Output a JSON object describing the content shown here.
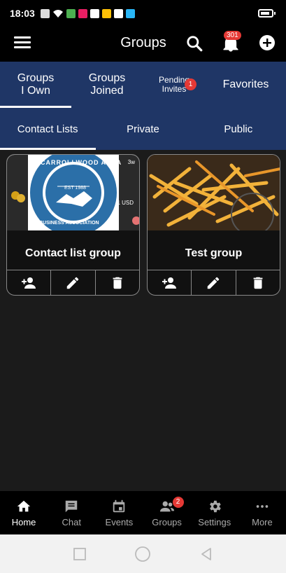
{
  "status_bar": {
    "time": "18:03"
  },
  "app_bar": {
    "title": "Groups",
    "notification_count": "301"
  },
  "main_tabs": [
    {
      "label": "Groups I Own",
      "active": true
    },
    {
      "label": "Groups Joined",
      "active": false
    },
    {
      "label": "Pending Invites",
      "badge": "1",
      "active": false
    },
    {
      "label": "Favorites",
      "active": false
    }
  ],
  "sub_tabs": [
    {
      "label": "Contact Lists",
      "active": true
    },
    {
      "label": "Private",
      "active": false
    },
    {
      "label": "Public",
      "active": false
    }
  ],
  "cards": [
    {
      "name": "Contact list group",
      "image_logo_top": "CARROLLWOOD AREA",
      "image_logo_year": "EST 1988",
      "image_logo_bottom": "BUSINESS ASSOCIATION",
      "image_overlay_left": "3w",
      "image_overlay_right": "1 USD"
    },
    {
      "name": "Test group"
    }
  ],
  "bottom_nav": [
    {
      "label": "Home",
      "icon": "home-icon",
      "active": true
    },
    {
      "label": "Chat",
      "icon": "chat-icon",
      "active": false
    },
    {
      "label": "Events",
      "icon": "calendar-icon",
      "active": false
    },
    {
      "label": "Groups",
      "icon": "groups-icon",
      "badge": "2",
      "active": false
    },
    {
      "label": "Settings",
      "icon": "gear-icon",
      "active": false
    },
    {
      "label": "More",
      "icon": "more-icon",
      "active": false
    }
  ],
  "colors": {
    "primary": "#1f3666",
    "badge": "#e53935",
    "background": "#1b1b1b"
  }
}
